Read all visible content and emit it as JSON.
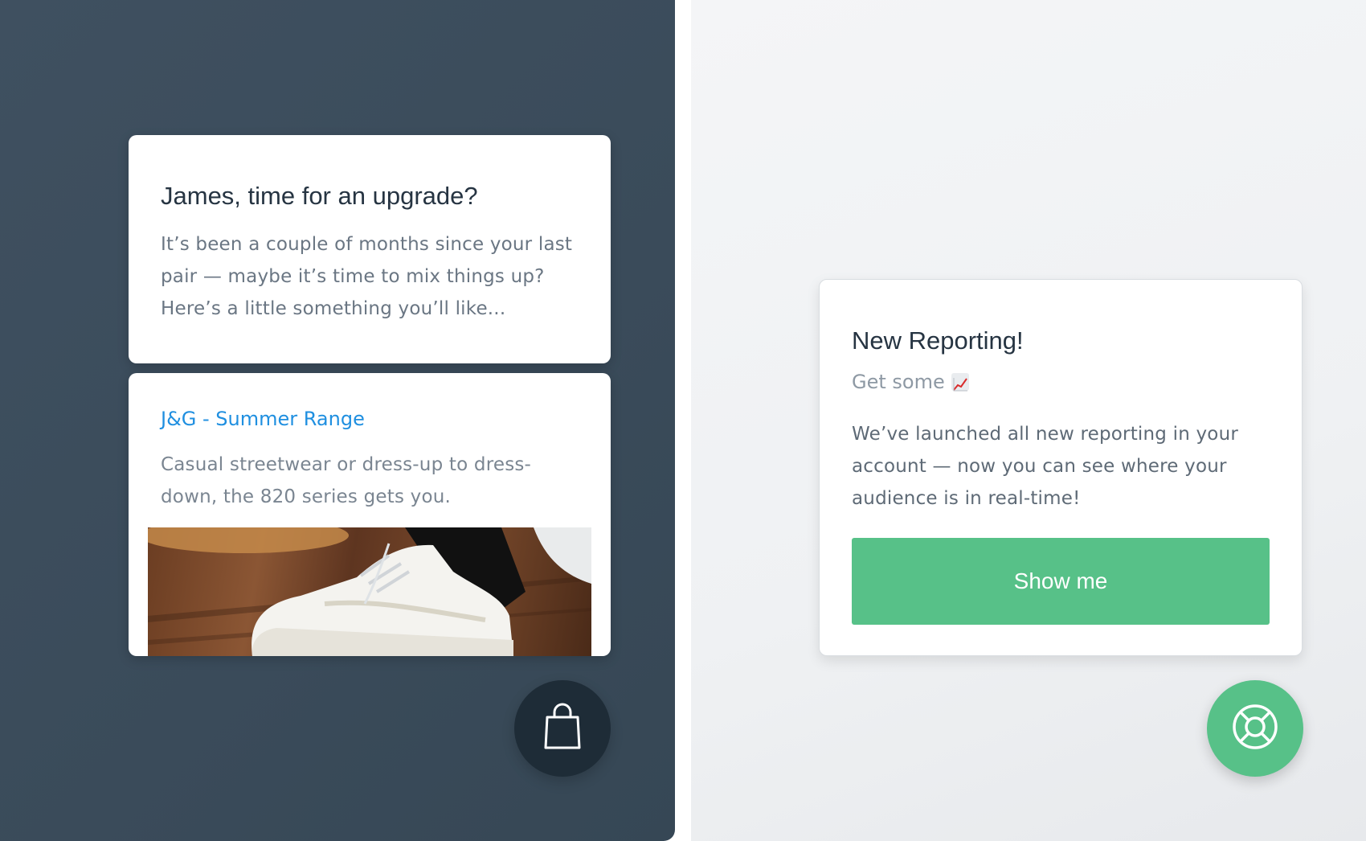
{
  "upgrade_card": {
    "title": "James, time for an upgrade?",
    "body": "It’s been a couple of months since your last pair — maybe it’s time to mix things up? Here’s a little something you’ll like..."
  },
  "product_card": {
    "link": "J&G - Summer Range",
    "body": "Casual streetwear or dress-up to dress-down, the 820 series gets you.",
    "image_icon": "white-sneaker-photo"
  },
  "report_card": {
    "title": "New Reporting!",
    "subtitle": "Get some",
    "subtitle_icon": "chart-increasing-emoji",
    "body": "We’ve launched all new reporting in your account — now you can see where your audience is in real-time!",
    "button_label": "Show me"
  },
  "launchers": {
    "left_icon": "shopping-bag-icon",
    "right_icon": "lifebuoy-icon"
  },
  "colors": {
    "left_background": "#3d4e5d",
    "right_background": "#f1f2f4",
    "accent_green": "#57c188",
    "link_blue": "#1f8fe0",
    "dark_fab": "#1e2c37"
  }
}
